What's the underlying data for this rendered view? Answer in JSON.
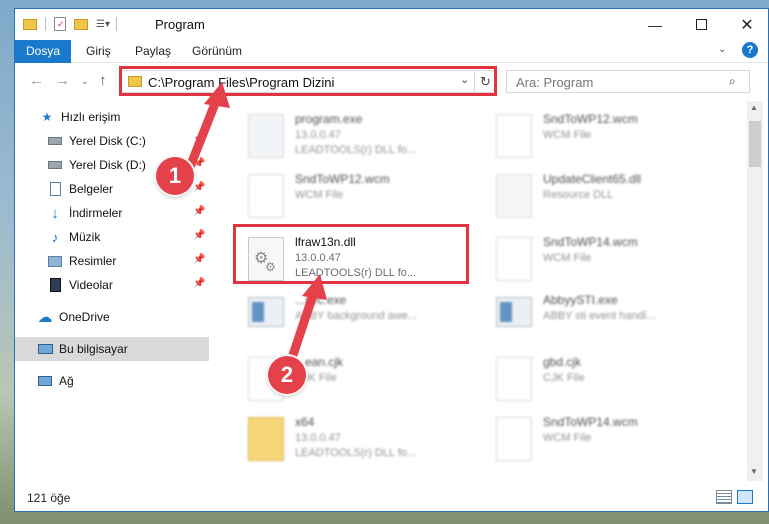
{
  "window": {
    "title": "Program"
  },
  "titlebar": {
    "quick_access_icons": [
      "folder-icon",
      "properties-icon",
      "new-folder-icon",
      "customize-icon"
    ]
  },
  "ribbon": {
    "tabs": [
      "Dosya",
      "Giriş",
      "Paylaş",
      "Görünüm"
    ]
  },
  "address": {
    "path": "C:\\Program Files\\Program Dizini"
  },
  "search": {
    "placeholder": "Ara: Program"
  },
  "sidebar": {
    "items": [
      {
        "label": "Hızlı erişim",
        "icon": "star-icon"
      },
      {
        "label": "Yerel Disk (C:)",
        "icon": "drive-icon",
        "pinned": true
      },
      {
        "label": "Yerel Disk (D:)",
        "icon": "drive-icon",
        "pinned": true
      },
      {
        "label": "Belgeler",
        "icon": "document-icon",
        "pinned": true
      },
      {
        "label": "İndirmeler",
        "icon": "download-icon",
        "pinned": true
      },
      {
        "label": "Müzik",
        "icon": "music-icon",
        "pinned": true
      },
      {
        "label": "Resimler",
        "icon": "pictures-icon",
        "pinned": true
      },
      {
        "label": "Videolar",
        "icon": "video-icon",
        "pinned": true
      },
      {
        "label": "OneDrive",
        "icon": "cloud-icon"
      },
      {
        "label": "Bu bilgisayar",
        "icon": "computer-icon",
        "selected": true
      },
      {
        "label": "Ağ",
        "icon": "network-icon"
      }
    ]
  },
  "files": [
    {
      "name": "program.exe",
      "line1": "13.0.0.47",
      "line2": "LEADTOOLS(r) DLL fo...",
      "type": "exe",
      "blurred": true
    },
    {
      "name": "SndToWP12.wcm",
      "line1": "WCM File",
      "line2": "",
      "type": "file",
      "blurred": true
    },
    {
      "name": "SndToWP12.wcm",
      "line1": "WCM File",
      "line2": "",
      "type": "file",
      "blurred": true
    },
    {
      "name": "UpdateClient65.dll",
      "line1": "Resource DLL",
      "line2": "",
      "type": "dll",
      "blurred": true
    },
    {
      "name": "lfraw13n.dll",
      "line1": "13.0.0.47",
      "line2": "LEADTOOLS(r) DLL fo...",
      "type": "dll",
      "blurred": false,
      "highlighted": true
    },
    {
      "name": "SndToWP14.wcm",
      "line1": "WCM File",
      "line2": "",
      "type": "file",
      "blurred": true
    },
    {
      "name": "...sec.exe",
      "line1": "ABBY background awe...",
      "line2": "",
      "type": "exe-window",
      "blurred": true
    },
    {
      "name": "AbbyySTI.exe",
      "line1": "ABBY sti event handl...",
      "line2": "",
      "type": "exe-window",
      "blurred": true
    },
    {
      "name": "...ean.cjk",
      "line1": "CJK File",
      "line2": "",
      "type": "file",
      "blurred": true
    },
    {
      "name": "gbd.cjk",
      "line1": "CJK File",
      "line2": "",
      "type": "file",
      "blurred": true
    },
    {
      "name": "x64",
      "line1": "13.0.0.47",
      "line2": "LEADTOOLS(r) DLL fo...",
      "type": "folder",
      "blurred": true
    },
    {
      "name": "SndToWP14.wcm",
      "line1": "WCM File",
      "line2": "",
      "type": "file",
      "blurred": true
    }
  ],
  "status": {
    "count_text": "121 öğe"
  },
  "callouts": [
    "1",
    "2"
  ],
  "colors": {
    "accent": "#1979ca",
    "highlight": "#e0343f",
    "callout": "#e4414b"
  }
}
